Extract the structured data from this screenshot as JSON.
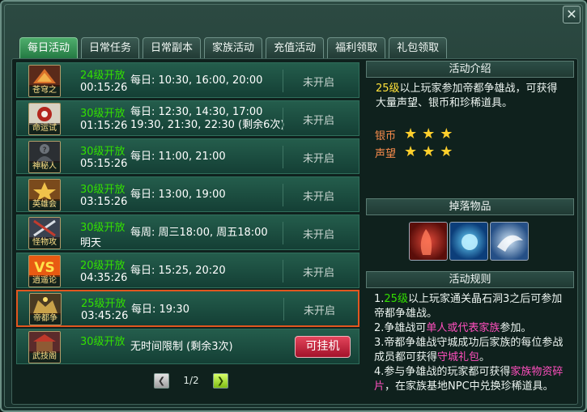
{
  "window": {
    "close_glyph": "✕"
  },
  "tabs": [
    {
      "label": "每日活动",
      "active": true
    },
    {
      "label": "日常任务"
    },
    {
      "label": "日常副本"
    },
    {
      "label": "家族活动"
    },
    {
      "label": "充值活动"
    },
    {
      "label": "福利领取"
    },
    {
      "label": "礼包领取"
    }
  ],
  "activities": [
    {
      "icon_caption": "苍穹之翼",
      "icon": "winged-beast-icon",
      "level": "24级开放",
      "timer": "00:15:26",
      "schedule": [
        "每日: 10:30, 16:00, 20:00"
      ],
      "status": "未开启"
    },
    {
      "icon_caption": "命运试炼",
      "icon": "trial-emblem-icon",
      "level": "30级开放",
      "timer": "01:15:26",
      "schedule": [
        "每日: 12:30, 14:30, 17:00",
        "19:30, 21:30, 22:30 (剩余6次)"
      ],
      "status": "未开启"
    },
    {
      "icon_caption": "神秘人",
      "icon": "mystery-figure-icon",
      "level": "30级开放",
      "timer": "05:15:26",
      "schedule": [
        "每日: 11:00, 21:00"
      ],
      "status": "未开启"
    },
    {
      "icon_caption": "英雄会",
      "icon": "hero-gathering-icon",
      "level": "30级开放",
      "timer": "03:15:26",
      "schedule": [
        "每日: 13:00, 19:00"
      ],
      "status": "未开启"
    },
    {
      "icon_caption": "怪物攻城",
      "icon": "monster-siege-icon",
      "level": "30级开放",
      "timer": "明天",
      "schedule": [
        "每周: 周三18:00, 周五18:00"
      ],
      "status": "未开启"
    },
    {
      "icon_caption": "逍遥论剑",
      "icon": "vs-duel-icon",
      "level": "20级开放",
      "timer": "04:35:26",
      "schedule": [
        "每日: 15:25, 20:20"
      ],
      "status": "未开启"
    },
    {
      "icon_caption": "帝都争雄",
      "icon": "imperial-contest-icon",
      "level": "25级开放",
      "timer": "03:45:26",
      "schedule": [
        "每日: 19:30"
      ],
      "status": "未开启",
      "selected": true
    },
    {
      "icon_caption": "武技阁",
      "icon": "martial-hall-icon",
      "level": "30级开放",
      "timer": "",
      "schedule": [
        "无时间限制 (剩余3次)"
      ],
      "button": "可挂机"
    }
  ],
  "pager": {
    "text": "1/2",
    "prev_glyph": "❮",
    "next_glyph": "❯"
  },
  "intro": {
    "title": "活动介绍",
    "level": "25级",
    "text_a": "以上玩家参加帝都争雄战，可获得",
    "text_b": "大量声望、银币和珍稀道具。",
    "rewards": [
      {
        "label": "银币",
        "stars": 3
      },
      {
        "label": "声望",
        "stars": 3
      }
    ]
  },
  "drops": {
    "title": "掉落物品",
    "items": [
      {
        "icon": "red-claw-relic-icon",
        "color": "#b3221c"
      },
      {
        "icon": "blue-orb-icon",
        "color": "#1a8fd6"
      },
      {
        "icon": "silver-wing-icon",
        "color": "#3d7fc0"
      }
    ]
  },
  "rules": {
    "title": "活动规则",
    "r1_prefix": "1.",
    "r1_level": "25级",
    "r1_text": "以上玩家通关晶石洞3之后可参加",
    "r1_line2": "帝都争雄战。",
    "r2_prefix": "2.争雄战可",
    "r2_highlight": "单人或代表家族",
    "r2_suffix": "参加。",
    "r3_line1": "3.帝都争雄战守城成功后家族的每位参战",
    "r3_prefix": "成员都可获得",
    "r3_highlight": "守城礼包",
    "r3_suffix": "。",
    "r4_prefix": "4.参与争雄战的玩家都可获得",
    "r4_highlight_a": "家族物资碎",
    "r4_highlight_b": "片",
    "r4_suffix": "，在家族基地NPC中兑换珍稀道具。"
  },
  "colors": {
    "accent_green": "#33e000",
    "highlight_yellow": "#ffe23a",
    "highlight_pink": "#ff4fbe",
    "selected_border": "#e2561f",
    "star": "#ffcf2c"
  }
}
